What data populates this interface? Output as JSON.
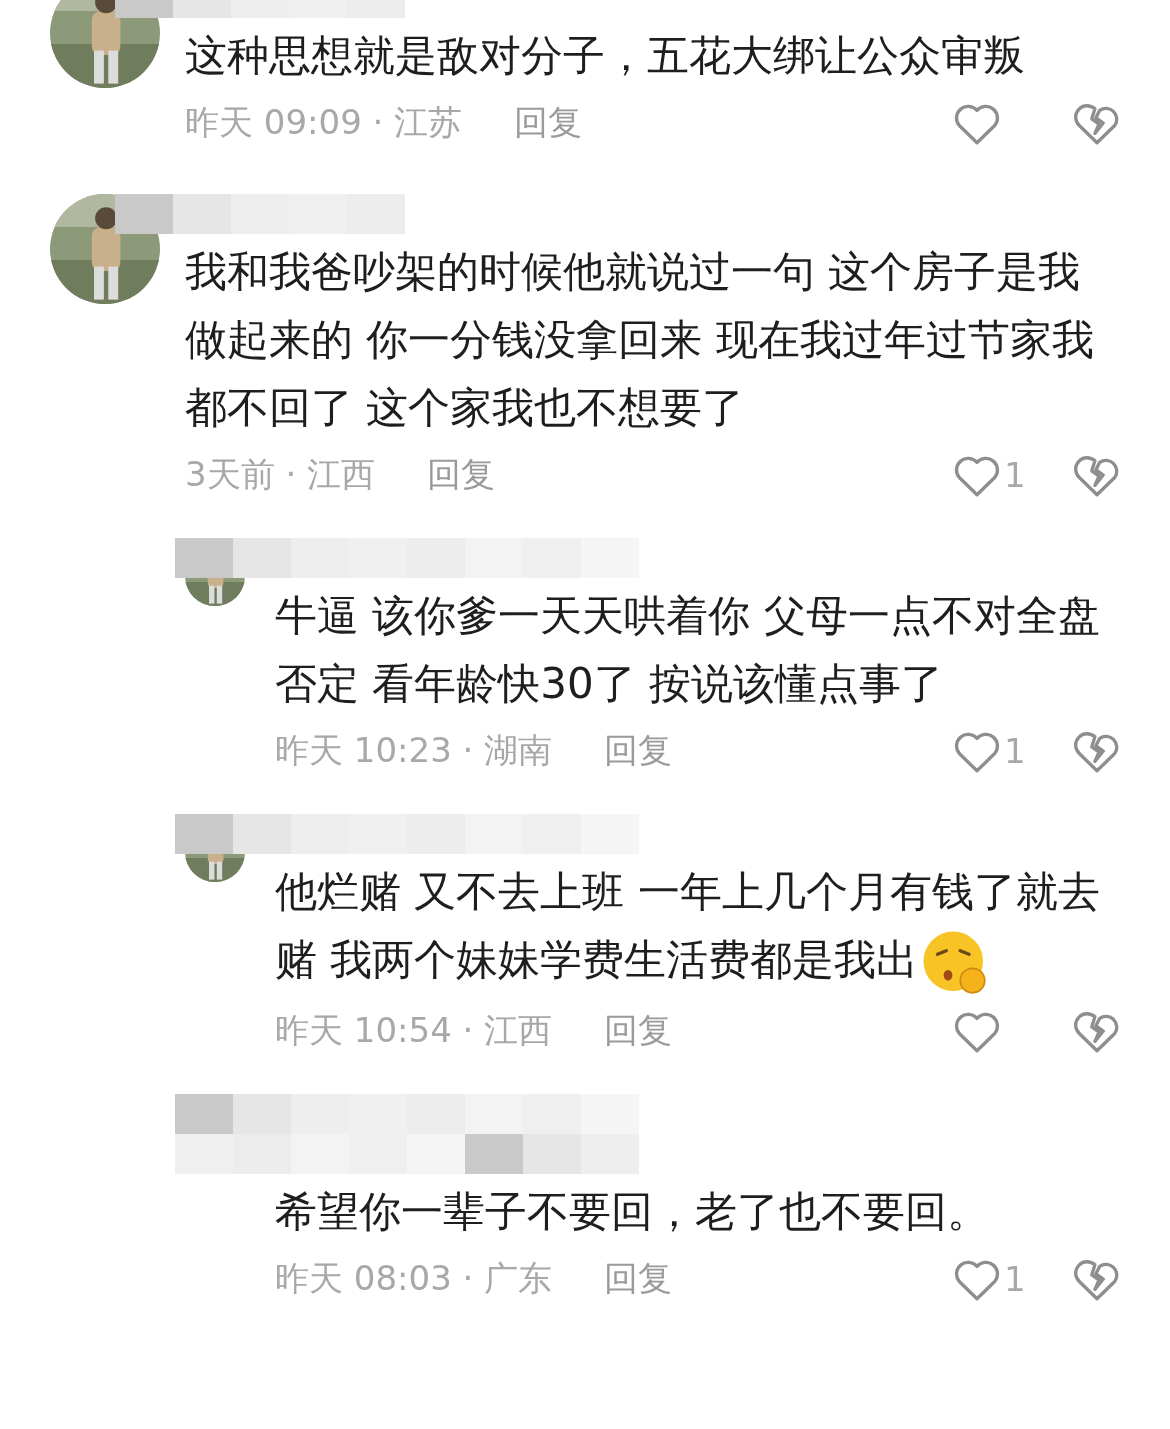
{
  "comments": [
    {
      "text": "这种思想就是敌对分子，五花大绑让公众审叛",
      "time_location": "昨天 09:09 · 江苏",
      "reply_label": "回复"
    },
    {
      "text": "我和我爸吵架的时候他就说过一句 这个房子是我做起来的 你一分钱没拿回来 现在我过年过节家我都不回了 这个家我也不想要了",
      "time_location": "3天前 · 江西",
      "reply_label": "回复",
      "like_count": "1",
      "replies": [
        {
          "text": "牛逼 该你爹一天天哄着你 父母一点不对全盘否定 看年龄快30了  按说该懂点事了",
          "time_location": "昨天 10:23 · 湖南",
          "reply_label": "回复",
          "like_count": "1"
        },
        {
          "text": "他烂赌 又不去上班 一年上几个月有钱了就去赌 我两个妹妹学费生活费都是我出",
          "emoji": true,
          "time_location": "昨天 10:54 · 江西",
          "reply_label": "回复"
        },
        {
          "text": "希望你一辈子不要回，老了也不要回。",
          "time_location": "昨天 08:03 · 广东",
          "reply_label": "回复",
          "like_count": "1"
        }
      ]
    }
  ]
}
